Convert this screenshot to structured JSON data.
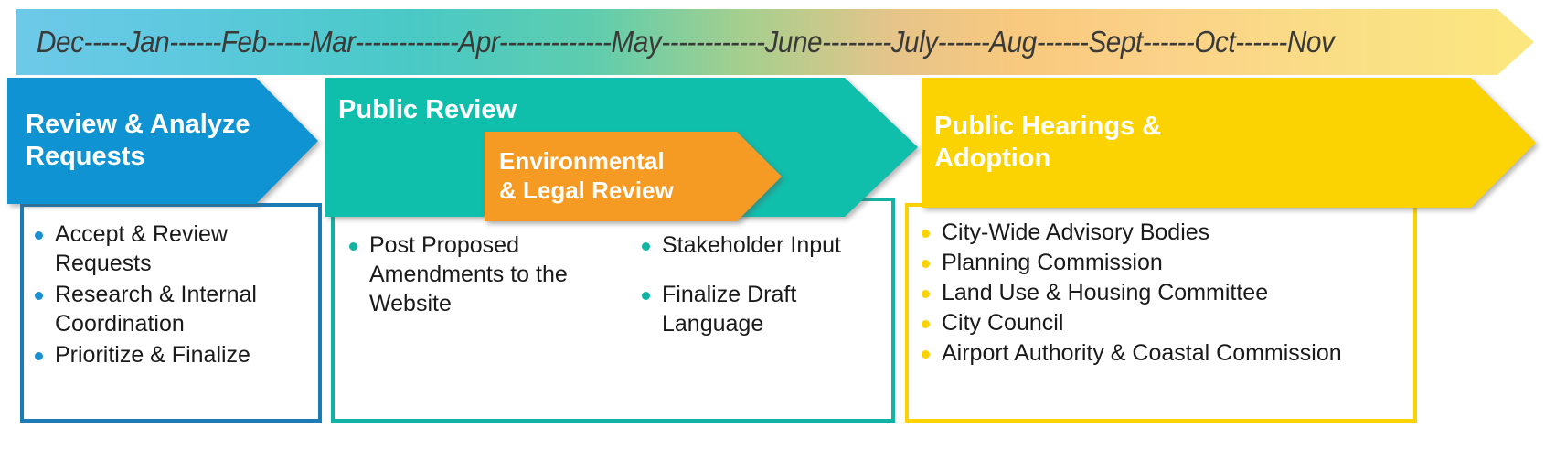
{
  "timeline": {
    "label": "Dec-----Jan------Feb-----Mar------------Apr-------------May------------June--------July------Aug------Sept------Oct------Nov",
    "months": [
      "Dec",
      "Jan",
      "Feb",
      "Mar",
      "Apr",
      "May",
      "June",
      "July",
      "Aug",
      "Sept",
      "Oct",
      "Nov"
    ],
    "gradient_start_color": "#6ec9e8",
    "gradient_mid_color": "#49c9c6",
    "gradient_end_color": "#fbe77f"
  },
  "phases": [
    {
      "id": "review-analyze-requests",
      "title": "Review & Analyze\nRequests",
      "color": "#0f93d2",
      "border_color": "#1b7cb5",
      "bullets": [
        "Accept & Review Requests",
        "Research & Internal Coordination",
        "Prioritize & Finalize"
      ]
    },
    {
      "id": "public-review",
      "title": "Public Review",
      "color": "#0fbfac",
      "border_color": "#12b3a3",
      "bullets_column_one": [
        "Post Proposed Amendments to the Website"
      ],
      "bullets_column_two": [
        "Stakeholder Input",
        "Finalize Draft Language"
      ]
    },
    {
      "id": "environmental-legal-review",
      "title": "Environmental\n& Legal Review",
      "color": "#f59a23",
      "bullets": []
    },
    {
      "id": "public-hearings-adoption",
      "title": "Public Hearings &\nAdoption",
      "color": "#fbd303",
      "border_color": "#fbd303",
      "bullets": [
        "City-Wide Advisory Bodies",
        "Planning Commission",
        "Land Use & Housing Committee",
        "City Council",
        "Airport Authority & Coastal Commission"
      ]
    }
  ]
}
